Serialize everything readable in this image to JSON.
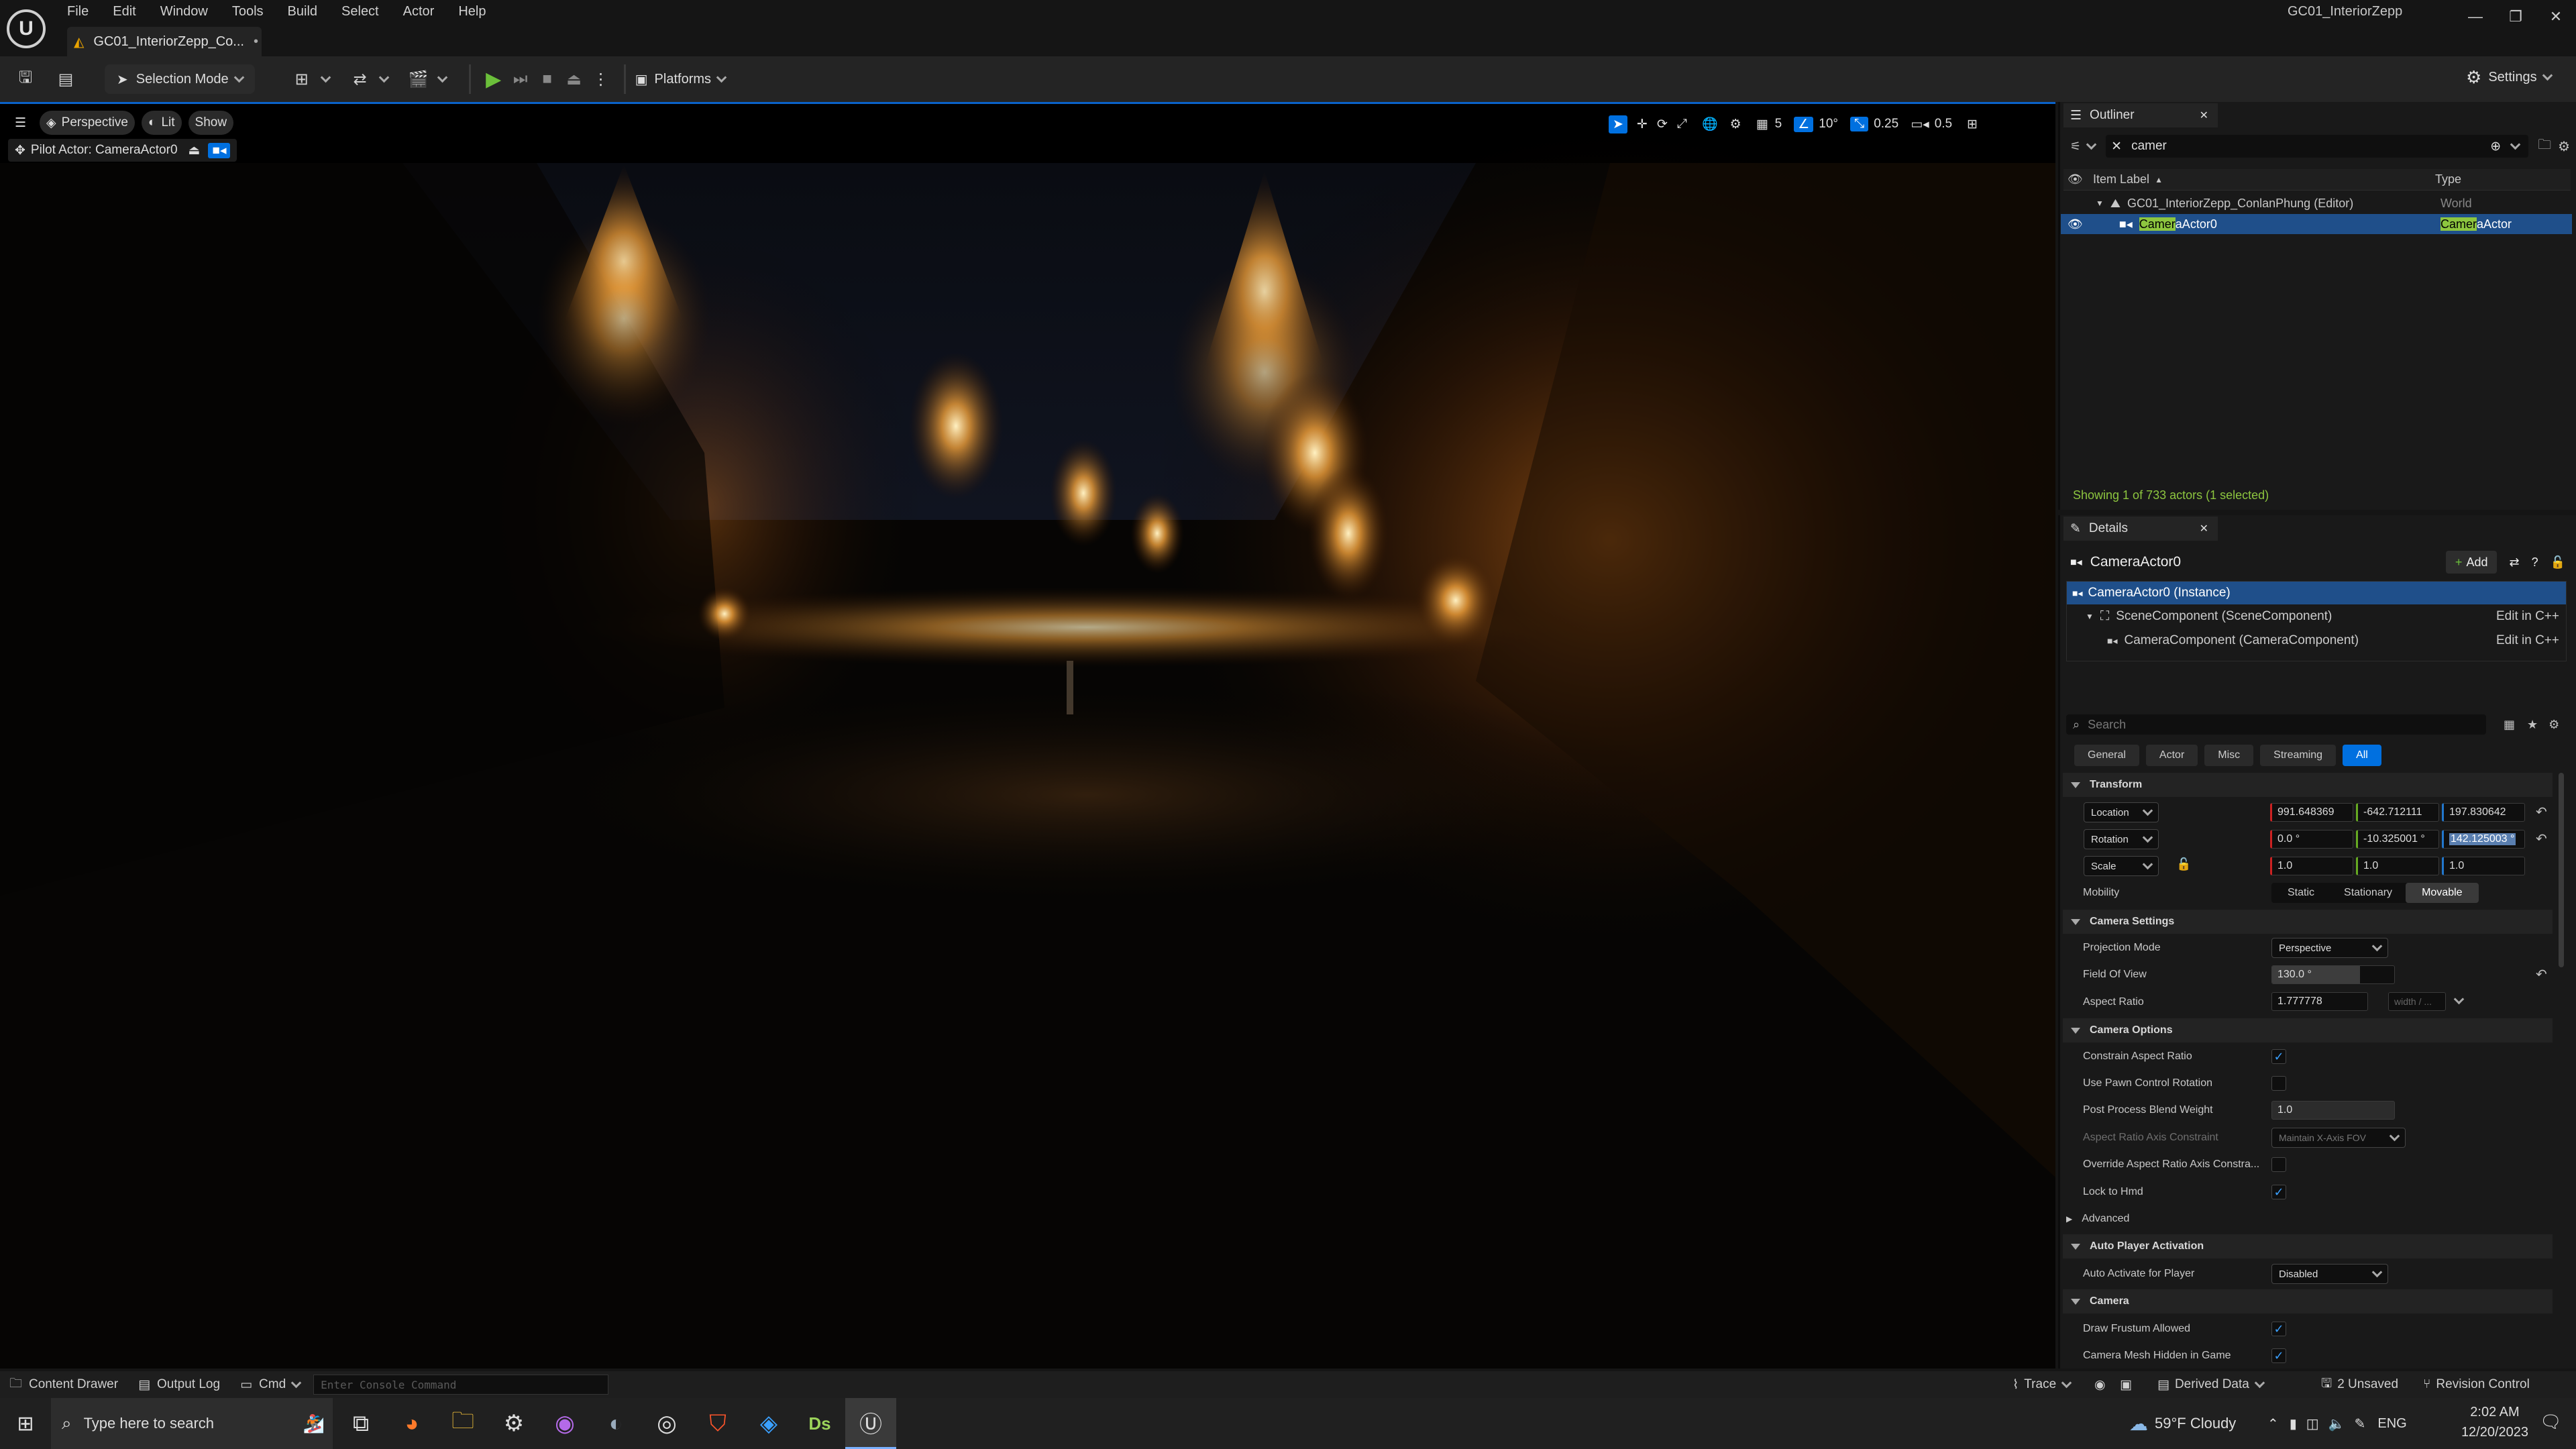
{
  "app": {
    "window_title": "GC01_InteriorZepp",
    "tab_title": "GC01_InteriorZepp_Co...",
    "menu": [
      "File",
      "Edit",
      "Window",
      "Tools",
      "Build",
      "Select",
      "Actor",
      "Help"
    ]
  },
  "toolbar": {
    "selection_mode_label": "Selection Mode",
    "platforms_label": "Platforms",
    "settings_label": "Settings"
  },
  "viewport": {
    "perspective_label": "Perspective",
    "lit_label": "Lit",
    "show_label": "Show",
    "pilot_label": "Pilot Actor: CameraActor0",
    "grid_size": "5",
    "angle_snap": "10°",
    "scale_snap": "0.25",
    "camera_speed": "0.5"
  },
  "outliner": {
    "tab_label": "Outliner",
    "search_value": "camer",
    "col_item_label": "Item Label",
    "col_type": "Type",
    "rows": [
      {
        "label": "GC01_InteriorZepp_ConlanPhung (Editor)",
        "type": "World"
      },
      {
        "label_hl": "Camer",
        "label_rest": "aActor0",
        "type_hl": "Camer",
        "type_rest": "aActor"
      }
    ],
    "status": "Showing 1 of 733 actors (1 selected)"
  },
  "details": {
    "tab_label": "Details",
    "actor_name": "CameraActor0",
    "add_label": "Add",
    "components": [
      {
        "label": "CameraActor0 (Instance)",
        "edit": ""
      },
      {
        "label": "SceneComponent (SceneComponent)",
        "edit": "Edit in C++"
      },
      {
        "label": "CameraComponent (CameraComponent)",
        "edit": "Edit in C++"
      }
    ],
    "search_placeholder": "Search",
    "filter_tabs": [
      "General",
      "Actor",
      "Misc",
      "Streaming",
      "All"
    ],
    "transform": {
      "title": "Transform",
      "location_label": "Location",
      "location": [
        "991.648369",
        "-642.712111",
        "197.830642"
      ],
      "rotation_label": "Rotation",
      "rotation": [
        "0.0 °",
        "-10.325001 °",
        "142.125003 °"
      ],
      "scale_label": "Scale",
      "scale": [
        "1.0",
        "1.0",
        "1.0"
      ],
      "mobility_label": "Mobility",
      "mobility_options": [
        "Static",
        "Stationary",
        "Movable"
      ],
      "mobility_selected": "Movable"
    },
    "camera_settings": {
      "title": "Camera Settings",
      "projection_mode_label": "Projection Mode",
      "projection_mode": "Perspective",
      "fov_label": "Field Of View",
      "fov": "130.0 °",
      "fov_fill": 0.72,
      "aspect_label": "Aspect Ratio",
      "aspect": "1.777778",
      "aspect_placeholder": "width / ..."
    },
    "camera_options": {
      "title": "Camera Options",
      "constrain_label": "Constrain Aspect Ratio",
      "constrain": true,
      "pawn_label": "Use Pawn Control Rotation",
      "pawn": false,
      "blend_label": "Post Process Blend Weight",
      "blend": "1.0",
      "axis_label": "Aspect Ratio Axis Constraint",
      "axis_value": "Maintain X-Axis FOV",
      "override_label": "Override Aspect Ratio Axis Constra...",
      "override": false,
      "hmd_label": "Lock to Hmd",
      "hmd": true,
      "advanced_label": "Advanced"
    },
    "auto_player": {
      "title": "Auto Player Activation",
      "activate_label": "Auto Activate for Player",
      "activate_value": "Disabled"
    },
    "camera": {
      "title": "Camera",
      "frustum_label": "Draw Frustum Allowed",
      "frustum": true,
      "mesh_hidden_label": "Camera Mesh Hidden in Game",
      "mesh_hidden": true
    }
  },
  "bottom_bar": {
    "content_drawer": "Content Drawer",
    "output_log": "Output Log",
    "cmd": "Cmd",
    "console_placeholder": "Enter Console Command",
    "trace": "Trace",
    "derived_data": "Derived Data",
    "unsaved": "2 Unsaved",
    "revision_control": "Revision Control"
  },
  "taskbar": {
    "search_placeholder": "Type here to search",
    "weather": "59°F  Cloudy",
    "lang": "ENG",
    "time": "2:02 AM",
    "date": "12/20/2023",
    "ds_label": "Ds"
  },
  "colors": {
    "accent": "#0070e0",
    "highlight": "#8dc63f",
    "selected_row": "#1f4f8a",
    "play_green": "#6bbf3a"
  }
}
